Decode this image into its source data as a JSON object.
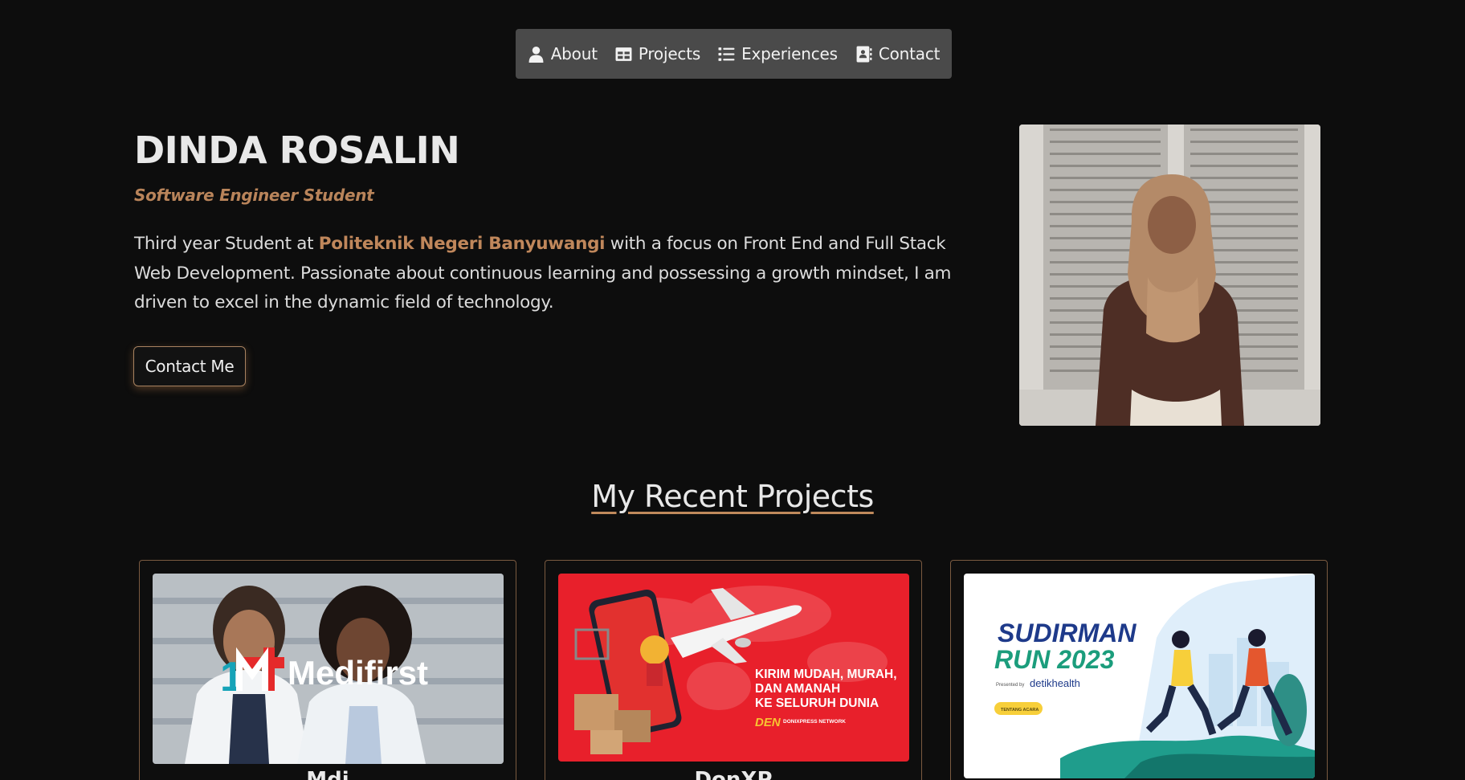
{
  "nav": {
    "items": [
      {
        "label": "About",
        "icon": "user-icon"
      },
      {
        "label": "Projects",
        "icon": "grid-icon"
      },
      {
        "label": "Experiences",
        "icon": "list-icon"
      },
      {
        "label": "Contact",
        "icon": "address-book-icon"
      }
    ]
  },
  "hero": {
    "name": "DINDA ROSALIN",
    "role": "Software Engineer Student",
    "bio_prefix": "Third year Student at ",
    "bio_highlight": "Politeknik Negeri Banyuwangi",
    "bio_suffix": " with a focus on Front End and Full Stack Web Development. Passionate about continuous learning and possessing a growth mindset, I am driven to excel in the dynamic field of technology.",
    "contact_button": "Contact Me"
  },
  "projects": {
    "section_title": "My Recent Projects",
    "cards": [
      {
        "image_text": "Medifirst",
        "title": "Mdi"
      },
      {
        "image_text_lines": [
          "KIRIM MUDAH, MURAH,",
          "DAN AMANAH",
          "KE SELURUH DUNIA"
        ],
        "image_brand": "DEN",
        "image_brand_sub": "DONIXPRESS NETWORK",
        "title": "DonXP"
      },
      {
        "image_text_lines": [
          "SUDIRMAN",
          "RUN 2023"
        ],
        "image_sponsor_prefix": "Presented by",
        "image_sponsor": "detikhealth",
        "image_button": "TENTANG ACARA",
        "title": ""
      }
    ]
  },
  "colors": {
    "background": "#0d0d0d",
    "nav_bg": "#4a4a4a",
    "accent": "#c0875b",
    "text": "#e6e6e6"
  }
}
